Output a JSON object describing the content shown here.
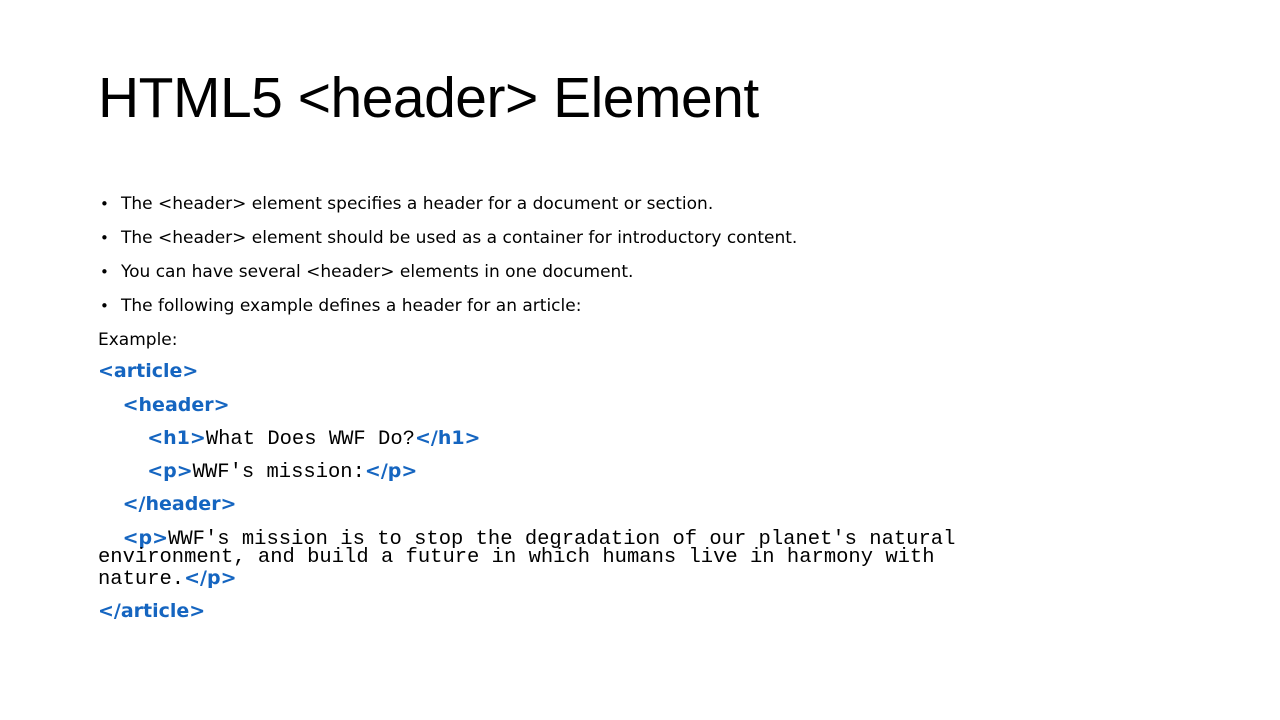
{
  "slide": {
    "title": "HTML5 <header> Element",
    "bullets": [
      "The <header> element specifies a header for a document or section.",
      "The <header> element should be used as a container for introductory content.",
      "You can have several <header> elements in one document.",
      "The following example defines a header for an article:"
    ],
    "example_label": "Example:",
    "code": {
      "article_open": "<article>",
      "header_open": "<header>",
      "h1_open": "<h1>",
      "h1_text": "What Does WWF Do?",
      "h1_close": "</h1>",
      "p_open": "<p>",
      "p1_text": "WWF's mission:",
      "p_close": "</p>",
      "header_close": "</header>",
      "p2_line1": "WWF's mission is to stop the degradation of our planet's natural",
      "p2_line2": "environment, and build a future in which humans live in harmony with",
      "p2_line3": "nature.",
      "article_close": "</article>"
    },
    "colors": {
      "tag": "#1565c0",
      "text": "#000000"
    }
  }
}
